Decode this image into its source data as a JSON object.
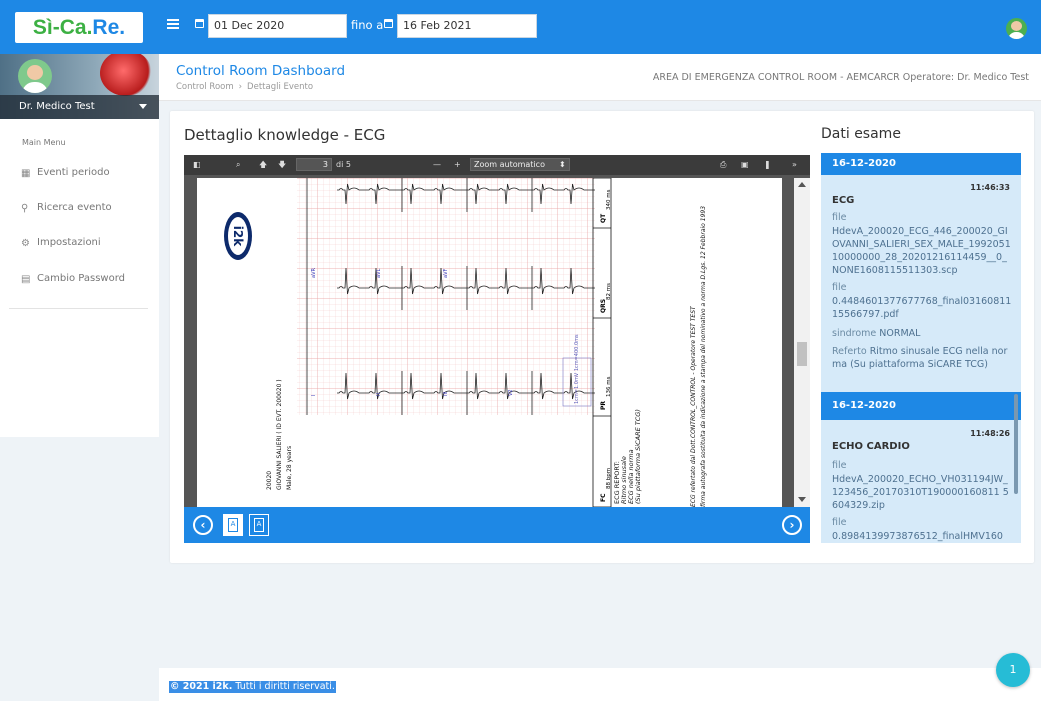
{
  "app": {
    "logo_left": "Sì-Ca.",
    "logo_right": "Re."
  },
  "header": {
    "date_from": "01 Dec 2020",
    "date_to_label": "fino a",
    "date_to": "16 Feb 2021"
  },
  "sidebar": {
    "user_name": "Dr. Medico Test",
    "menu_title": "Main Menu",
    "items": [
      {
        "label": "Eventi periodo",
        "icon": "calendar-icon"
      },
      {
        "label": "Ricerca evento",
        "icon": "search-icon"
      },
      {
        "label": "Impostazioni",
        "icon": "settings-icon"
      },
      {
        "label": "Cambio Password",
        "icon": "file-lock-icon"
      }
    ]
  },
  "subheader": {
    "title": "Control Room Dashboard",
    "breadcrumb": [
      "Control Room",
      "Dettagli Evento"
    ],
    "area_info": "AREA DI EMERGENZA CONTROL ROOM - AEMCARCR Operatore: Dr. Medico Test"
  },
  "detail": {
    "title": "Dettaglio knowledge - ECG"
  },
  "pdf_viewer": {
    "page_current": "3",
    "page_total": "di 5",
    "zoom": "Zoom automatico",
    "ecg_leads": [
      "aVR",
      "aVL",
      "aVF",
      "I",
      "II",
      "III",
      "V2"
    ],
    "intervals": [
      {
        "label": "QT",
        "value": "340 ms"
      },
      {
        "label": "QRS",
        "value": "82 ms"
      },
      {
        "label": "PR",
        "value": "136 ms"
      },
      {
        "label": "FC",
        "value": "88 bpm"
      }
    ],
    "scale": "1cm=1.0mV 1cm=400.0ms",
    "patient_lines": [
      "GIOVANNI SALIERI ( ID EVT. 200020 )",
      "Male, 28 years",
      "20020"
    ],
    "report_lines": [
      "ECG REPORT:",
      "Ritmo sinusale",
      "ECG nella norma",
      "(Su piattaforma SiCARE TCG)"
    ],
    "signature_lines": [
      "ECG refertato dal Dott.CONTROL_CONTROL - Operatore TEST TEST",
      "firma autografa sostituita da indicazione a stampa del nominativo a norma D.Lgs. 12 Febbraio 1993"
    ]
  },
  "dati_esame": {
    "title": "Dati esame",
    "groups": [
      {
        "date": "16-12-2020",
        "time": "11:46:33",
        "name": "ECG",
        "file1_label": "file",
        "file1": "HdevA_200020_ECG_446_200020_GIOVANNI_SALIERI_SEX_MALE_199205110000000_28_20201216114459__0_NONE1608115511303.scp",
        "file2_label": "file",
        "file2": "0.4484601377677768_final0316081115566797.pdf",
        "sindrome_label": "sindrome",
        "sindrome": "NORMAL",
        "referto_label": "Referto",
        "referto": "Ritmo sinusale ECG nella norma (Su piattaforma SiCARE TCG)"
      },
      {
        "date": "16-12-2020",
        "time": "11:48:26",
        "name": "ECHO CARDIO",
        "file1_label": "file",
        "file1": "HdevA_200020_ECHO_VH031194JW_123456_20170310T190000160811 5604329.zip",
        "file2_label": "file",
        "file2": "0.8984139973876512_finalHMV160"
      }
    ]
  },
  "footer": {
    "year": "© 2021 i2k.",
    "rights": "Tutti i diritti riservati."
  },
  "fab": {
    "label": "1"
  },
  "colors": {
    "primary": "#1e88e5",
    "entry_bg": "#d6eaf9",
    "fab": "#26bcd6"
  }
}
